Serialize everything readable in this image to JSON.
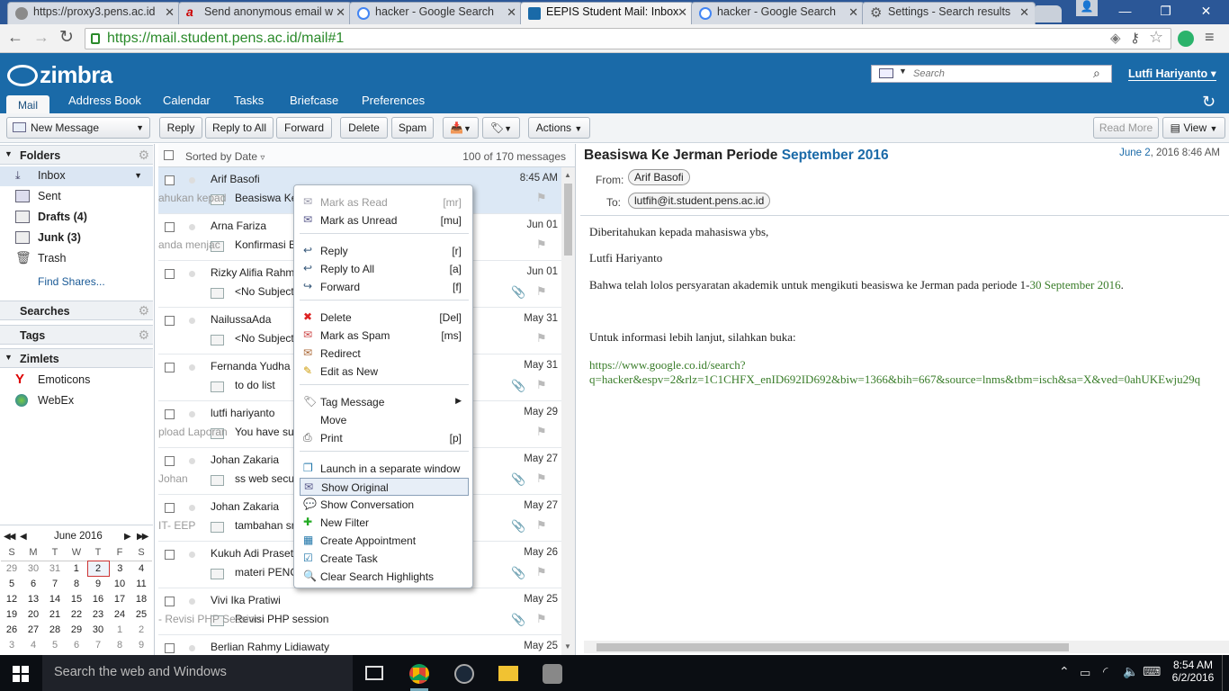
{
  "browser": {
    "tabs": [
      {
        "label": "https://proxy3.pens.ac.id"
      },
      {
        "label": "Send anonymous email w"
      },
      {
        "label": "hacker - Google Search"
      },
      {
        "label": "EEPIS Student Mail: Inbox"
      },
      {
        "label": "hacker - Google Search"
      },
      {
        "label": "Settings - Search results"
      }
    ],
    "url": "https://mail.student.pens.ac.id/mail#1"
  },
  "header": {
    "logo": "zimbra",
    "search_placeholder": "Search",
    "user": "Lutfi Hariyanto",
    "tabs": [
      "Mail",
      "Address Book",
      "Calendar",
      "Tasks",
      "Briefcase",
      "Preferences"
    ]
  },
  "toolbar": {
    "new_message": "New Message",
    "reply": "Reply",
    "reply_all": "Reply to All",
    "forward": "Forward",
    "delete": "Delete",
    "spam": "Spam",
    "actions": "Actions",
    "read_more": "Read More",
    "view": "View"
  },
  "sidebar": {
    "folders_title": "Folders",
    "folders": [
      {
        "name": "Inbox"
      },
      {
        "name": "Sent"
      },
      {
        "name": "Drafts (4)"
      },
      {
        "name": "Junk (3)"
      },
      {
        "name": "Trash"
      }
    ],
    "find_shares": "Find Shares...",
    "searches": "Searches",
    "tags": "Tags",
    "zimlets": "Zimlets",
    "zimlet_items": [
      "Emoticons",
      "WebEx"
    ]
  },
  "calendar": {
    "month": "June 2016",
    "weekdays": [
      "S",
      "M",
      "T",
      "W",
      "T",
      "F",
      "S"
    ],
    "weeks": [
      [
        "29",
        "30",
        "31",
        "1",
        "2",
        "3",
        "4"
      ],
      [
        "5",
        "6",
        "7",
        "8",
        "9",
        "10",
        "11"
      ],
      [
        "12",
        "13",
        "14",
        "15",
        "16",
        "17",
        "18"
      ],
      [
        "19",
        "20",
        "21",
        "22",
        "23",
        "24",
        "25"
      ],
      [
        "26",
        "27",
        "28",
        "29",
        "30",
        "1",
        "2"
      ],
      [
        "3",
        "4",
        "5",
        "6",
        "7",
        "8",
        "9"
      ]
    ],
    "today": "2"
  },
  "list": {
    "sorted": "Sorted by Date",
    "count": "100 of 170 messages",
    "messages": [
      {
        "from": "Arif Basofi",
        "date": "8:45 AM",
        "subject": "Beasiswa Ke J",
        "fragment": "ahukan kepad"
      },
      {
        "from": "Arna Fariza",
        "date": "Jun 01",
        "subject": "Konfirmasi Be",
        "fragment": "anda menjac"
      },
      {
        "from": "Rizky Alifia Rahman",
        "date": "Jun 01",
        "subject": "<No Subject>",
        "fragment": ""
      },
      {
        "from": "NailussaAda",
        "date": "May 31",
        "subject": "<No Subject>",
        "fragment": ""
      },
      {
        "from": "Fernanda Yudha Pr",
        "date": "May 31",
        "subject": "to do list",
        "fragment": ""
      },
      {
        "from": "lutfi hariyanto",
        "date": "May 29",
        "subject": "You have subr",
        "fragment": "pload Laporan"
      },
      {
        "from": "Johan Zakaria",
        "date": "May 27",
        "subject": "ss web secure",
        "fragment": "Johan"
      },
      {
        "from": "Johan Zakaria",
        "date": "May 27",
        "subject": "tambahan sno",
        "fragment": "IT- EEP"
      },
      {
        "from": "Kukuh Adi Prasetyo",
        "date": "May 26",
        "subject": "materi PENCI",
        "fragment": ""
      },
      {
        "from": "Vivi Ika Pratiwi",
        "date": "May 25",
        "subject": "Revisi PHP session",
        "fragment": "- Revisi PHP Session"
      },
      {
        "from": "Berlian Rahmy Lidiawaty",
        "date": "May 25",
        "subject": "",
        "fragment": ""
      }
    ]
  },
  "reading": {
    "subject_main": "Beasiswa Ke Jerman Periode",
    "subject_highlight": "September 2016",
    "date_prefix": "June",
    "date_day": "2",
    "date_rest": ", 2016 8:46 AM",
    "from_label": "From:",
    "from": "Arif Basofi",
    "to_label": "To:",
    "to": "lutfih@it.student.pens.ac.id",
    "body": {
      "line1": "Diberitahukan kepada mahasiswa ybs,",
      "line2": "Lutfi Hariyanto",
      "line3": "Bahwa telah lolos persyaratan akademik untuk mengikuti beasiswa ke Jerman pada periode 1-",
      "line3_link": "30 September 2016",
      "line3_end": ".",
      "line4": "Untuk informasi lebih lanjut, silahkan buka:",
      "link1": "https://www.google.co.id/search?",
      "link2": "q=hacker&espv=2&rlz=1C1CHFX_enID692ID692&biw=1366&bih=667&source=lnms&tbm=isch&sa=X&ved=0ahUKEwju29q"
    }
  },
  "context_menu": [
    {
      "label": "Mark as Read",
      "shortcut": "[mr]",
      "disabled": true
    },
    {
      "label": "Mark as Unread",
      "shortcut": "[mu]"
    },
    {
      "label": "Reply",
      "shortcut": "[r]"
    },
    {
      "label": "Reply to All",
      "shortcut": "[a]"
    },
    {
      "label": "Forward",
      "shortcut": "[f]"
    },
    {
      "label": "Delete",
      "shortcut": "[Del]"
    },
    {
      "label": "Mark as Spam",
      "shortcut": "[ms]"
    },
    {
      "label": "Redirect",
      "shortcut": ""
    },
    {
      "label": "Edit as New",
      "shortcut": ""
    },
    {
      "label": "Tag Message",
      "shortcut": ""
    },
    {
      "label": "Move",
      "shortcut": ""
    },
    {
      "label": "Print",
      "shortcut": "[p]"
    },
    {
      "label": "Launch in a separate window",
      "shortcut": ""
    },
    {
      "label": "Show Original",
      "shortcut": ""
    },
    {
      "label": "Show Conversation",
      "shortcut": ""
    },
    {
      "label": "New Filter",
      "shortcut": ""
    },
    {
      "label": "Create Appointment",
      "shortcut": ""
    },
    {
      "label": "Create Task",
      "shortcut": ""
    },
    {
      "label": "Clear Search Highlights",
      "shortcut": ""
    }
  ],
  "taskbar": {
    "search": "Search the web and Windows",
    "time": "8:54 AM",
    "date": "6/2/2016"
  },
  "colors": {
    "zimbra_blue": "#1a6aa8",
    "link_green": "#3a7d2a",
    "tab_blue": "#2b5797"
  }
}
